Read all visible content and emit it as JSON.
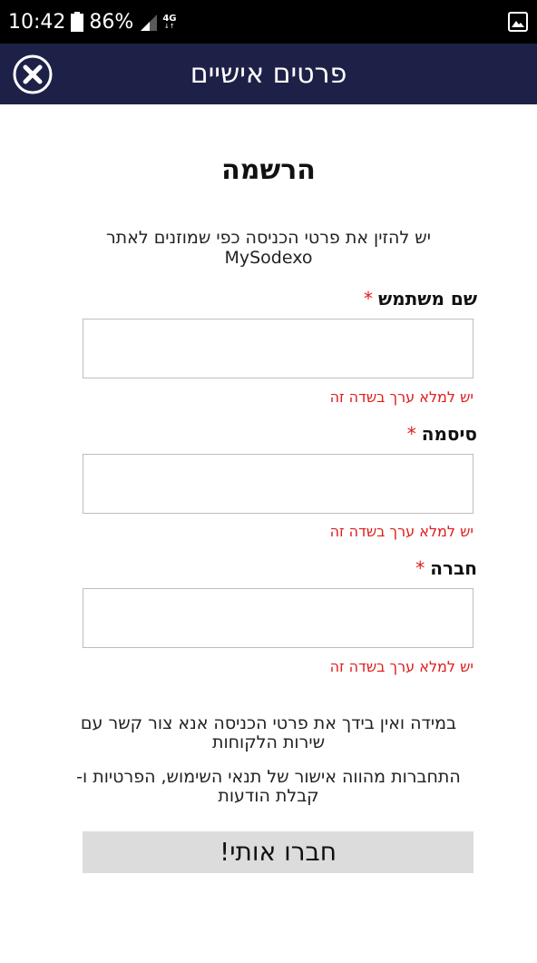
{
  "status_bar": {
    "time": "10:42",
    "battery": "86%",
    "network": "4G",
    "battery_icon": "battery-icon",
    "signal_icon": "signal-icon",
    "notification_icon": "image-icon"
  },
  "header": {
    "title": "פרטים אישיים",
    "close_icon": "close-icon"
  },
  "form": {
    "title": "הרשמה",
    "intro_line1": "יש להזין את פרטי הכניסה כפי שמוזנים לאתר",
    "intro_line2": "MySodexo",
    "required_mark": "*",
    "fields": [
      {
        "label": "שם משתמש",
        "value": "",
        "error": "יש למלא ערך בשדה זה"
      },
      {
        "label": "סיסמה",
        "value": "",
        "error": "יש למלא ערך בשדה זה"
      },
      {
        "label": "חברה",
        "value": "",
        "error": "יש למלא ערך בשדה זה"
      }
    ],
    "help_text": "במידה ואין בידך את פרטי הכניסה אנא צור קשר עם שירות הלקוחות",
    "terms_text": "התחברות מהווה אישור של תנאי השימוש, הפרטיות ו- קבלת הודעות",
    "submit_label": "חברו אותי!"
  },
  "colors": {
    "header_bg": "#1e2147",
    "error": "#e21b1b",
    "button_bg": "#dcdcdc"
  }
}
